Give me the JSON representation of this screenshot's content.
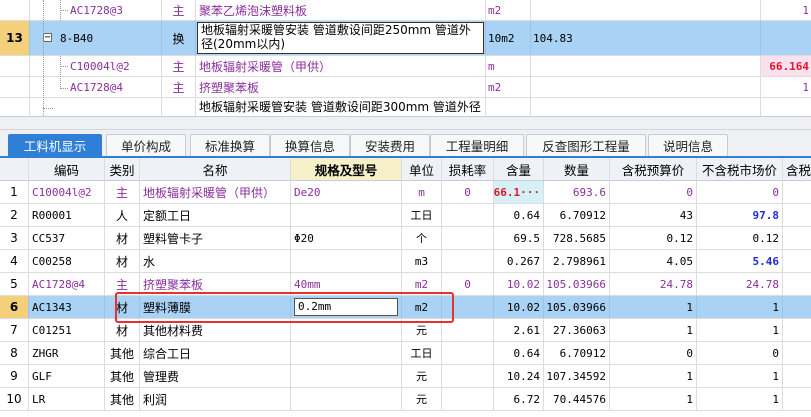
{
  "top_rows": [
    {
      "row": "",
      "code": "AC1728@3",
      "kind": "主",
      "name": "聚苯乙烯泡沫塑料板",
      "unit": "m2",
      "amount": "",
      "extra": "1"
    },
    {
      "row": "13",
      "code": "8-B40",
      "kind": "换",
      "name": "地板辐射采暖管安装 管道敷设间距250mm 管道外径(20mm以内)",
      "unit": "10m2",
      "amount": "104.83",
      "extra": ""
    },
    {
      "row": "",
      "code": "C10004l@2",
      "kind": "主",
      "name": "地板辐射采暖管（甲供）",
      "unit": "m",
      "amount": "",
      "extra": "66.164"
    },
    {
      "row": "",
      "code": "AC1728@4",
      "kind": "主",
      "name": "挤塑聚苯板",
      "unit": "m2",
      "amount": "",
      "extra": "1"
    },
    {
      "row": "",
      "code": "",
      "kind": "",
      "name": "地板辐射采暖管安装 管道敷设间距300mm 管道外径",
      "unit": "",
      "amount": "",
      "extra": ""
    }
  ],
  "expander_symbol": "−",
  "tabs": [
    "工料机显示",
    "单价构成",
    "标准换算",
    "换算信息",
    "安装费用",
    "工程量明细",
    "反查图形工程量",
    "说明信息"
  ],
  "active_tab": 0,
  "columns": [
    "编码",
    "类别",
    "名称",
    "规格及型号",
    "单位",
    "损耗率",
    "含量",
    "数量",
    "含税预算价",
    "不含税市场价",
    "含税"
  ],
  "rows": [
    {
      "n": "1",
      "code": "C10004l@2",
      "kind": "主",
      "name": "地板辐射采暖管（甲供）",
      "spec": "De20",
      "unit": "m",
      "loss": "0",
      "qty": "66.1···",
      "amt": "693.6",
      "p1": "0",
      "p2": "0"
    },
    {
      "n": "2",
      "code": "R00001",
      "kind": "人",
      "name": "定额工日",
      "spec": "",
      "unit": "工日",
      "loss": "",
      "qty": "0.64",
      "amt": "6.70912",
      "p1": "43",
      "p2": "97.8"
    },
    {
      "n": "3",
      "code": "CC537",
      "kind": "材",
      "name": "塑料管卡子",
      "spec": "Φ20",
      "unit": "个",
      "loss": "",
      "qty": "69.5",
      "amt": "728.5685",
      "p1": "0.12",
      "p2": "0.12"
    },
    {
      "n": "4",
      "code": "C00258",
      "kind": "材",
      "name": "水",
      "spec": "",
      "unit": "m3",
      "loss": "",
      "qty": "0.267",
      "amt": "2.798961",
      "p1": "4.05",
      "p2": "5.46"
    },
    {
      "n": "5",
      "code": "AC1728@4",
      "kind": "主",
      "name": "挤塑聚苯板",
      "spec": "40mm",
      "unit": "m2",
      "loss": "0",
      "qty": "10.02",
      "amt": "105.03966",
      "p1": "24.78",
      "p2": "24.78"
    },
    {
      "n": "6",
      "code": "AC1343",
      "kind": "材",
      "name": "塑料薄膜",
      "spec": "0.2mm",
      "unit": "m2",
      "loss": "",
      "qty": "10.02",
      "amt": "105.03966",
      "p1": "1",
      "p2": "1"
    },
    {
      "n": "7",
      "code": "C01251",
      "kind": "材",
      "name": "其他材料费",
      "spec": "",
      "unit": "元",
      "loss": "",
      "qty": "2.61",
      "amt": "27.36063",
      "p1": "1",
      "p2": "1"
    },
    {
      "n": "8",
      "code": "ZHGR",
      "kind": "其他",
      "name": "综合工日",
      "spec": "",
      "unit": "工日",
      "loss": "",
      "qty": "0.64",
      "amt": "6.70912",
      "p1": "0",
      "p2": "0"
    },
    {
      "n": "9",
      "code": "GLF",
      "kind": "其他",
      "name": "管理费",
      "spec": "",
      "unit": "元",
      "loss": "",
      "qty": "10.24",
      "amt": "107.34592",
      "p1": "1",
      "p2": "1"
    },
    {
      "n": "10",
      "code": "LR",
      "kind": "其他",
      "name": "利润",
      "spec": "",
      "unit": "元",
      "loss": "",
      "qty": "6.72",
      "amt": "70.44576",
      "p1": "1",
      "p2": "1"
    }
  ],
  "colors": {
    "accent": "#2f7fd6",
    "selection": "#a9d2f5",
    "highlight_box": "#e63131",
    "main_material_text": "#8b2f9c"
  }
}
